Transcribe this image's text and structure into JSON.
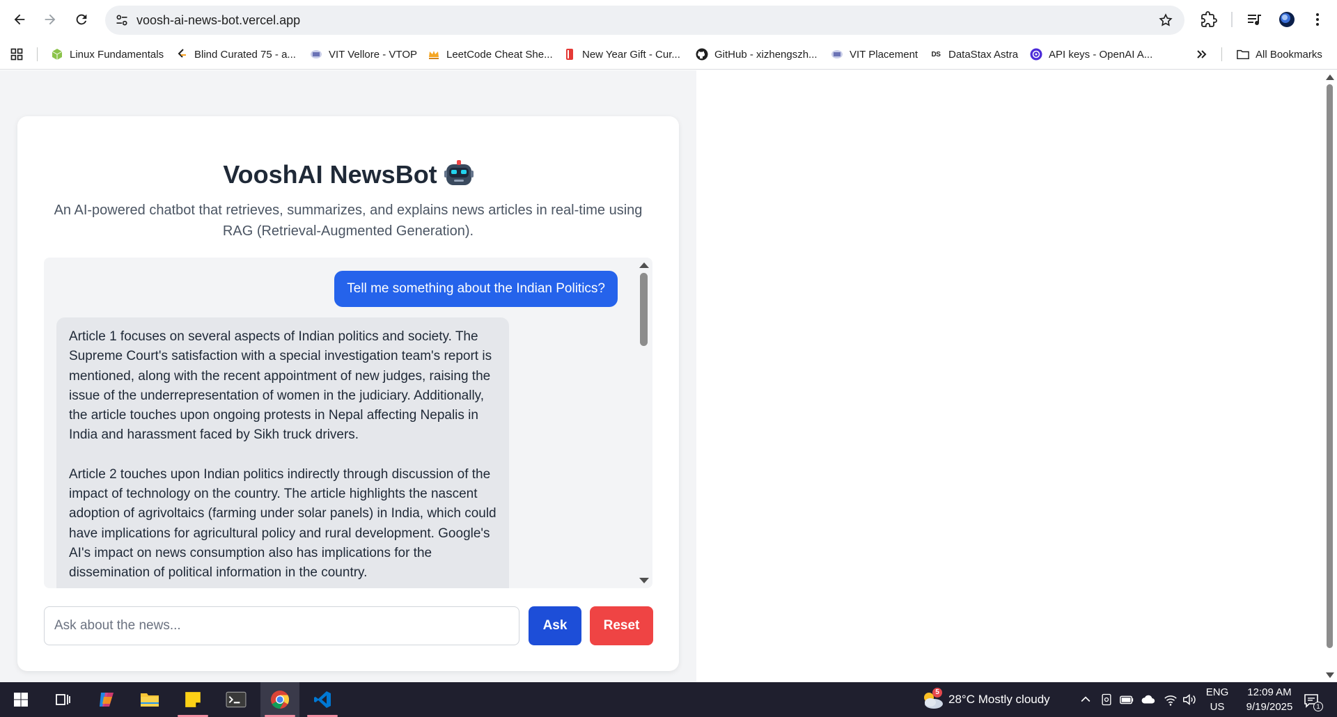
{
  "browser": {
    "url": "voosh-ai-news-bot.vercel.app",
    "bookmarks": [
      {
        "label": "Linux Fundamentals",
        "icon": "cube-icon"
      },
      {
        "label": "Blind Curated 75 - a...",
        "icon": "leetcode-icon"
      },
      {
        "label": "VIT Vellore - VTOP",
        "icon": "vit-icon"
      },
      {
        "label": "LeetCode Cheat She...",
        "icon": "crown-icon"
      },
      {
        "label": "New Year Gift - Cur...",
        "icon": "book-icon"
      },
      {
        "label": "GitHub - xizhengszh...",
        "icon": "github-icon"
      },
      {
        "label": "VIT Placement",
        "icon": "vit-icon"
      },
      {
        "label": "DataStax Astra",
        "icon": "datastax-icon"
      },
      {
        "label": "API keys - OpenAI A...",
        "icon": "openai-icon"
      }
    ],
    "all_bookmarks_label": "All Bookmarks"
  },
  "app": {
    "title": "VooshAI NewsBot",
    "subtitle": "An AI-powered chatbot that retrieves, summarizes, and explains news articles in real-time using RAG (Retrieval-Augmented Generation).",
    "messages": [
      {
        "role": "user",
        "text": "Tell me something about the Indian Politics?"
      },
      {
        "role": "bot",
        "paragraphs": [
          "Article 1 focuses on several aspects of Indian politics and society.  The Supreme Court's satisfaction with a special investigation team's report is mentioned, along with the recent appointment of new judges, raising the issue of the underrepresentation of women in the judiciary.  Additionally, the article touches upon ongoing protests in Nepal affecting Nepalis in India and harassment faced by Sikh truck drivers.",
          "Article 2 touches upon Indian politics indirectly through discussion of the impact of technology on the country.  The article highlights the nascent adoption of agrivoltaics (farming under solar panels) in India, which could have implications for agricultural policy and rural development.  Google's AI's impact on news consumption also has implications for the dissemination of political information in the country."
        ]
      }
    ],
    "input_placeholder": "Ask about the news...",
    "ask_label": "Ask",
    "reset_label": "Reset"
  },
  "taskbar": {
    "weather_badge": "5",
    "weather": "28°C  Mostly cloudy",
    "lang_top": "ENG",
    "lang_bottom": "US",
    "time": "12:09 AM",
    "date": "9/19/2025",
    "notification_count": "1"
  },
  "colors": {
    "accent": "#2563eb",
    "ask_button": "#1d4ed8",
    "reset_button": "#ef4444",
    "page_bg": "#f3f4f6",
    "bot_bubble": "#e5e7eb"
  }
}
